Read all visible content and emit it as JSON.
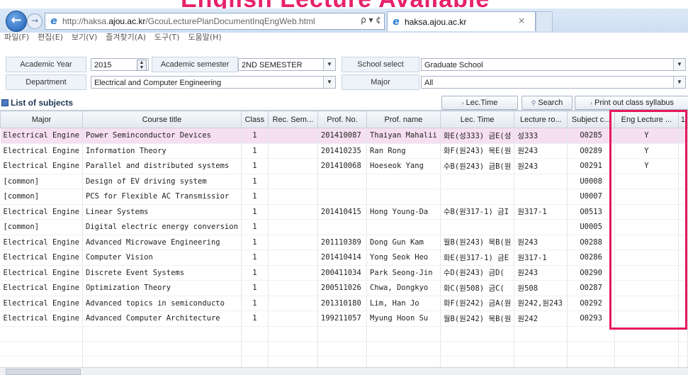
{
  "banner": {
    "text": "English Lecture Available"
  },
  "browser": {
    "url_prefix": "http://haksa.",
    "url_host": "ajou.ac.kr",
    "url_path": "/GcouLecturePlanDocumentInqEngWeb.html",
    "addr_tools": "ρ ▾ ¢",
    "tab_title": "haksa.ajou.ac.kr",
    "tab_close": "×",
    "back_glyph": "←",
    "forward_glyph": "→",
    "menu": [
      "파일(F)",
      "편집(E)",
      "보기(V)",
      "즐겨찾기(A)",
      "도구(T)",
      "도움말(H)"
    ]
  },
  "filters": {
    "academic_year_label": "Academic Year",
    "academic_year_value": "2015",
    "academic_semester_label": "Academic semester",
    "academic_semester_value": "2ND SEMESTER",
    "school_select_label": "School select",
    "school_select_value": "Graduate School",
    "department_label": "Department",
    "department_value": "Electrical and Computer Engineering",
    "major_label": "Major",
    "major_value": "All"
  },
  "list": {
    "title": "List of subjects",
    "lec_time_button": "Lec.Time",
    "search_button": "Search",
    "print_button": "Print out class syllabus"
  },
  "table": {
    "headers": [
      "Major",
      "Course title",
      "Class",
      "Rec. Sem...",
      "Prof. No.",
      "Prof. name",
      "Lec. Time",
      "Lecture ro...",
      "Subject c...",
      "Eng Lecture ...",
      "1"
    ],
    "rows": [
      [
        "Electrical Engine",
        "Power Seminconductor Devices",
        "1",
        "",
        "201410087",
        "Thaiyan Mahalii",
        "화E(성333) 금E(성",
        "성333",
        "O0285",
        "Y"
      ],
      [
        "Electrical Engine",
        "Information Theory",
        "1",
        "",
        "201410235",
        "Ran Rong",
        "화F(원243) 목E(원",
        "원243",
        "O0289",
        "Y"
      ],
      [
        "Electrical Engine",
        "Parallel and distributed systems",
        "1",
        "",
        "201410068",
        "Hoeseok Yang",
        "수B(원243) 금B(원",
        "원243",
        "O0291",
        "Y"
      ],
      [
        "[common]",
        "Design of EV driving system",
        "1",
        "",
        "",
        "",
        "",
        "",
        "U0008",
        ""
      ],
      [
        "[common]",
        "PCS for Flexible AC Transmissior",
        "1",
        "",
        "",
        "",
        "",
        "",
        "U0007",
        ""
      ],
      [
        "Electrical Engine",
        "Linear Systems",
        "1",
        "",
        "201410415",
        "Hong Young-Da",
        "수B(원317-1) 금I",
        "원317-1",
        "O0513",
        ""
      ],
      [
        "[common]",
        "Digital electric energy conversion",
        "1",
        "",
        "",
        "",
        "",
        "",
        "U0005",
        ""
      ],
      [
        "Electrical Engine",
        "Advanced Microwave Engineering",
        "1",
        "",
        "201110389",
        "Dong Gun Kam",
        "월B(원243) 목B(원",
        "원243",
        "O0288",
        ""
      ],
      [
        "Electrical Engine",
        "Computer Vision",
        "1",
        "",
        "201410414",
        "Yong Seok Heo",
        "화E(원317-1) 금E",
        "원317-1",
        "O0286",
        ""
      ],
      [
        "Electrical Engine",
        "Discrete Event Systems",
        "1",
        "",
        "200411034",
        "Park Seong-Jin",
        "수D(원243) 금D(",
        "원243",
        "O0290",
        ""
      ],
      [
        "Electrical Engine",
        "Optimization Theory",
        "1",
        "",
        "200511026",
        "Chwa, Dongkyo",
        "화C(원508) 금C(",
        "원508",
        "O0287",
        ""
      ],
      [
        "Electrical Engine",
        "Advanced topics in semiconducto",
        "1",
        "",
        "201310180",
        "Lim, Han Jo",
        "화F(원242) 금A(원",
        "원242,원243",
        "O0292",
        ""
      ],
      [
        "Electrical Engine",
        "Advanced Computer Architecture",
        "1",
        "",
        "199211057",
        "Myung Hoon Su",
        "월B(원242) 목B(원",
        "원242",
        "O0293",
        ""
      ]
    ]
  },
  "colors": {
    "highlight": "#e6195a",
    "selected_row": "#f5dff0"
  }
}
